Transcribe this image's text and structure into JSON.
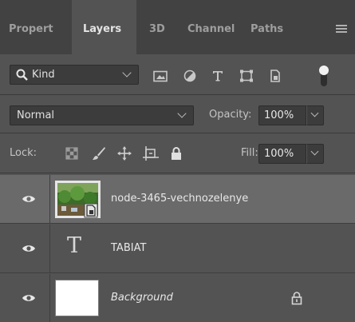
{
  "tabs": [
    {
      "label": "Propert",
      "active": false
    },
    {
      "label": "Layers",
      "active": true
    },
    {
      "label": "3D",
      "active": false
    },
    {
      "label": "Channel",
      "active": false
    },
    {
      "label": "Paths",
      "active": false
    }
  ],
  "filter": {
    "kind_label": "Kind",
    "icons": [
      "image-filter-icon",
      "adjustment-filter-icon",
      "type-filter-icon",
      "shape-filter-icon",
      "smart-object-filter-icon"
    ]
  },
  "blend": {
    "mode": "Normal",
    "opacity_label": "Opacity:",
    "opacity_value": "100%"
  },
  "lock": {
    "label": "Lock:",
    "icons": [
      "lock-transparent-pixels-icon",
      "lock-image-pixels-icon",
      "lock-position-icon",
      "lock-artboard-icon",
      "lock-all-icon"
    ],
    "fill_label": "Fill:",
    "fill_value": "100%"
  },
  "layers": [
    {
      "name": "node-3465-vechnozelenye",
      "type": "smart-object",
      "visible": true,
      "selected": true
    },
    {
      "name": "TABIAT",
      "type": "text",
      "visible": true,
      "selected": false,
      "glyph": "T"
    },
    {
      "name": "Background",
      "type": "background",
      "visible": true,
      "selected": false,
      "locked": true
    }
  ],
  "colors": {
    "panel_bg": "#535353",
    "tab_bar_bg": "#424242",
    "selected_row": "#6a6a6a",
    "field_bg": "#3c3c3c"
  }
}
